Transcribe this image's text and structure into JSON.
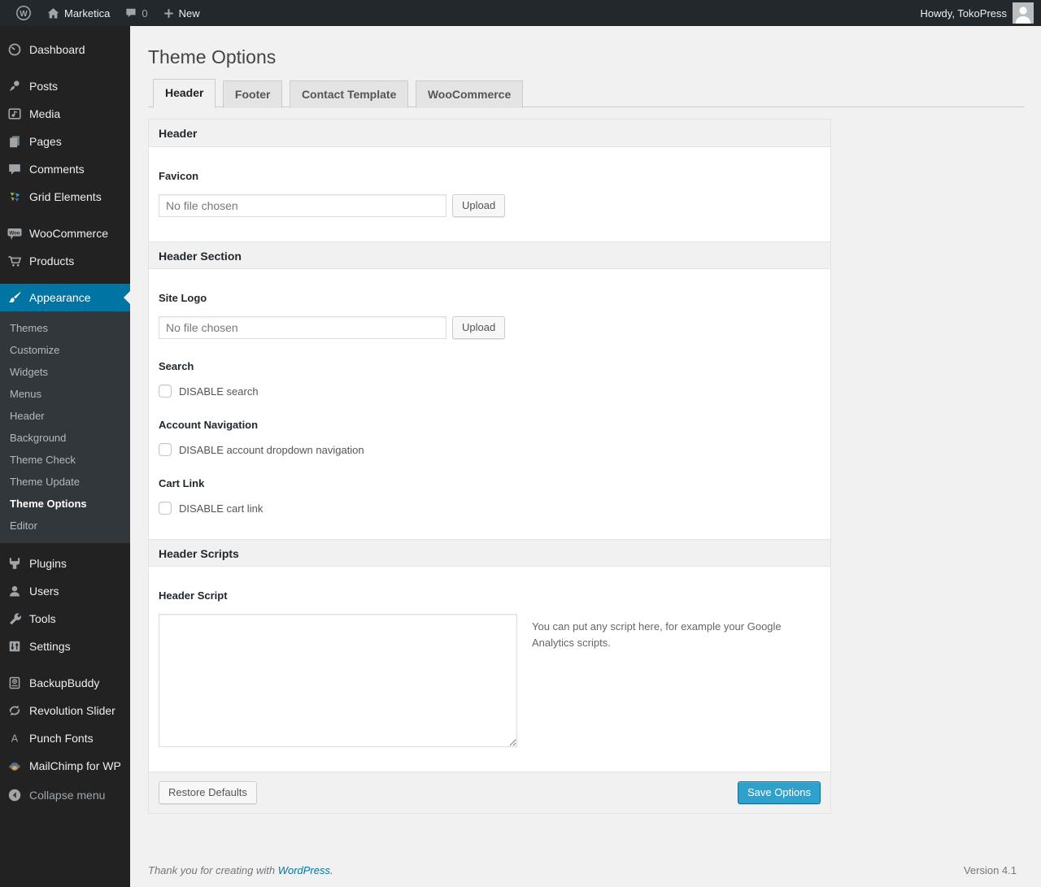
{
  "admin_bar": {
    "site_name": "Marketica",
    "comment_count": "0",
    "new_label": "New",
    "howdy_text": "Howdy, TokoPress"
  },
  "sidebar": {
    "items": [
      {
        "label": "Dashboard",
        "icon": "dashboard-icon"
      },
      {
        "label": "Posts",
        "icon": "pushpin-icon"
      },
      {
        "label": "Media",
        "icon": "media-icon"
      },
      {
        "label": "Pages",
        "icon": "pages-icon"
      },
      {
        "label": "Comments",
        "icon": "comments-icon"
      },
      {
        "label": "Grid Elements",
        "icon": "grid-elements-icon"
      },
      {
        "label": "WooCommerce",
        "icon": "woocommerce-icon"
      },
      {
        "label": "Products",
        "icon": "cart-icon"
      },
      {
        "label": "Appearance",
        "icon": "brush-icon",
        "active": true
      },
      {
        "label": "Plugins",
        "icon": "plugin-icon"
      },
      {
        "label": "Users",
        "icon": "user-icon"
      },
      {
        "label": "Tools",
        "icon": "wrench-icon"
      },
      {
        "label": "Settings",
        "icon": "settings-icon"
      },
      {
        "label": "BackupBuddy",
        "icon": "backup-icon"
      },
      {
        "label": "Revolution Slider",
        "icon": "refresh-icon"
      },
      {
        "label": "Punch Fonts",
        "icon": "letter-a-icon"
      },
      {
        "label": "MailChimp for WP",
        "icon": "mailchimp-icon"
      }
    ],
    "appearance_submenu": [
      "Themes",
      "Customize",
      "Widgets",
      "Menus",
      "Header",
      "Background",
      "Theme Check",
      "Theme Update",
      "Theme Options",
      "Editor"
    ],
    "active_submenu_item": "Theme Options",
    "collapse_label": "Collapse menu"
  },
  "page": {
    "title": "Theme Options",
    "tabs": [
      "Header",
      "Footer",
      "Contact Template",
      "WooCommerce"
    ],
    "active_tab": "Header"
  },
  "panel": {
    "section1_title": "Header",
    "favicon": {
      "label": "Favicon",
      "placeholder": "No file chosen",
      "button": "Upload"
    },
    "section2_title": "Header Section",
    "site_logo": {
      "label": "Site Logo",
      "placeholder": "No file chosen",
      "button": "Upload"
    },
    "search": {
      "label": "Search",
      "checkbox_label": "DISABLE search",
      "checked": false
    },
    "account_nav": {
      "label": "Account Navigation",
      "checkbox_label": "DISABLE account dropdown navigation",
      "checked": false
    },
    "cart_link": {
      "label": "Cart Link",
      "checkbox_label": "DISABLE cart link",
      "checked": false
    },
    "section3_title": "Header Scripts",
    "header_script": {
      "label": "Header Script",
      "value": "",
      "help": "You can put any script here, for example your Google Analytics scripts."
    },
    "restore_button": "Restore Defaults",
    "save_button": "Save Options"
  },
  "footer": {
    "thanks_prefix": "Thank you for creating with ",
    "wordpress_link": "WordPress.",
    "version": "Version 4.1"
  },
  "colors": {
    "accent_blue": "#0074a2",
    "primary_button": "#2ea2cc",
    "adminbar_bg": "#23282d",
    "sidebar_bg": "#222222",
    "submenu_bg": "#32373c",
    "body_bg": "#f1f1f1"
  }
}
